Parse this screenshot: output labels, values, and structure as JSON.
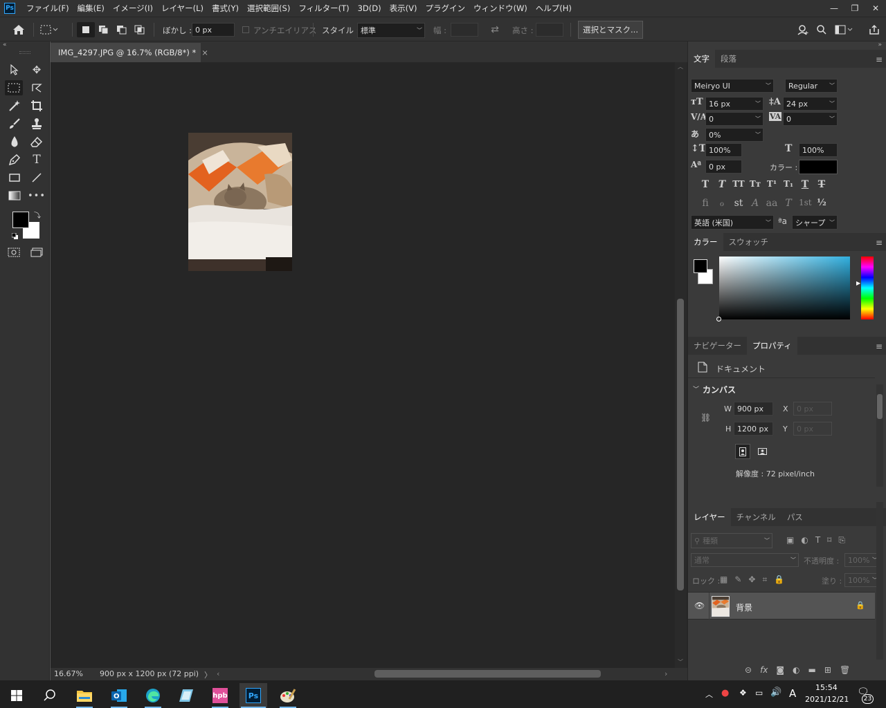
{
  "app": {
    "logo": "Ps"
  },
  "menu": [
    "ファイル(F)",
    "編集(E)",
    "イメージ(I)",
    "レイヤー(L)",
    "書式(Y)",
    "選択範囲(S)",
    "フィルター(T)",
    "3D(D)",
    "表示(V)",
    "プラグイン",
    "ウィンドウ(W)",
    "ヘルプ(H)"
  ],
  "window_controls": {
    "minimize": "—",
    "restore": "❐",
    "close": "✕"
  },
  "options": {
    "blur_label": "ぼかし :",
    "blur_value": "0 px",
    "antialias_label": "アンチエイリアス",
    "style_label": "スタイル :",
    "style_value": "標準",
    "width_label": "幅 :",
    "height_label": "高さ :",
    "select_mask_button": "選択とマスク..."
  },
  "document": {
    "tab_title": "IMG_4297.JPG @ 16.7% (RGB/8*) *",
    "tab_close": "×"
  },
  "status": {
    "zoom": "16.67%",
    "doc_info": "900 px x 1200 px (72 ppi)",
    "arrow": "〉"
  },
  "character_panel": {
    "tabs": [
      "文字",
      "段落"
    ],
    "font_family": "Meiryo UI",
    "font_style": "Regular",
    "font_size": "16 px",
    "leading": "24 px",
    "kerning": "0",
    "tracking": "0",
    "tsume": "0%",
    "vscale": "100%",
    "hscale": "100%",
    "baseline": "0 px",
    "color_label": "カラー :",
    "text_color": "#000000",
    "language": "英語 (米国)",
    "aa_label": "ªa",
    "antialias": "シャープ"
  },
  "color_panel": {
    "tabs": [
      "カラー",
      "スウォッチ"
    ],
    "foreground": "#000000",
    "background": "#ffffff",
    "hue_color": "#31b0e0"
  },
  "properties_panel": {
    "tabs": [
      "ナビゲーター",
      "プロパティ"
    ],
    "doc_label": "ドキュメント",
    "canvas_label": "カンバス",
    "w_label": "W",
    "w_value": "900 px",
    "x_label": "X",
    "x_value": "0 px",
    "h_label": "H",
    "h_value": "1200 px",
    "y_label": "Y",
    "y_value": "0 px",
    "resolution": "解像度 : 72 pixel/inch"
  },
  "layers_panel": {
    "tabs": [
      "レイヤー",
      "チャンネル",
      "パス"
    ],
    "filter_placeholder": "種類",
    "blend_mode": "通常",
    "opacity_label": "不透明度 :",
    "opacity": "100%",
    "lock_label": "ロック :",
    "fill_label": "塗り :",
    "fill": "100%",
    "layers": [
      {
        "name": "背景",
        "visible": true,
        "locked": true
      }
    ]
  },
  "taskbar": {
    "time": "15:54",
    "date": "2021/12/21",
    "notifications": "23",
    "ime": "A"
  }
}
